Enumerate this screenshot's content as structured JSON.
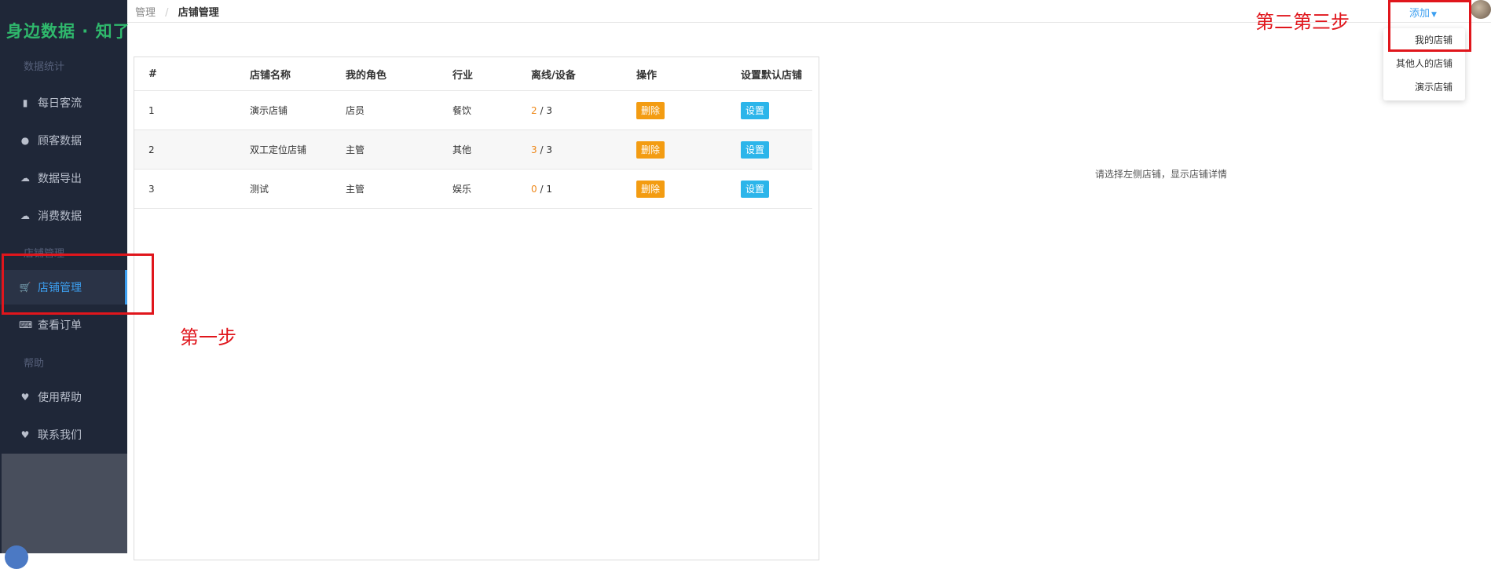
{
  "sidebar": {
    "brand": "身边数据 · 知了",
    "sections": [
      {
        "title": "数据统计"
      },
      {
        "title": "店铺管理"
      },
      {
        "title": "帮助"
      }
    ],
    "items": [
      {
        "label": "每日客流",
        "icon": "bar-chart-icon"
      },
      {
        "label": "顾客数据",
        "icon": "users-icon"
      },
      {
        "label": "数据导出",
        "icon": "cloud-upload-icon"
      },
      {
        "label": "消费数据",
        "icon": "cloud-upload-icon"
      },
      {
        "label": "店铺管理",
        "icon": "cart-icon",
        "active": true
      },
      {
        "label": "查看订单",
        "icon": "keyboard-icon"
      },
      {
        "label": "使用帮助",
        "icon": "heart-icon"
      },
      {
        "label": "联系我们",
        "icon": "heart-icon"
      }
    ],
    "colors": {
      "background": "#1f2738",
      "active": "#3c9ff0",
      "brand": "#2fb86c"
    }
  },
  "breadcrumb": {
    "root": "管理",
    "current": "店铺管理"
  },
  "header": {
    "add_label": "添加",
    "dropdown": [
      "我的店铺",
      "其他人的店铺",
      "演示店铺"
    ]
  },
  "table": {
    "columns": [
      "#",
      "店铺名称",
      "我的角色",
      "行业",
      "离线/设备",
      "操作",
      "设置默认店铺"
    ],
    "rows": [
      {
        "no": "1",
        "name": "演示店铺",
        "role": "店员",
        "industry": "餐饮",
        "offline": "2",
        "devices": "3",
        "action": "删除",
        "set": "设置"
      },
      {
        "no": "2",
        "name": "双工定位店铺",
        "role": "主管",
        "industry": "其他",
        "offline": "3",
        "devices": "3",
        "action": "删除",
        "set": "设置"
      },
      {
        "no": "3",
        "name": "测试",
        "role": "主管",
        "industry": "娱乐",
        "offline": "0",
        "devices": "1",
        "action": "删除",
        "set": "设置"
      }
    ],
    "colors": {
      "delete": "#f39c12",
      "set": "#2cb5ea",
      "offline": "#ee8a1e"
    }
  },
  "detail": {
    "placeholder": "请选择左侧店铺，显示店铺详情"
  },
  "annotations": {
    "step1": "第一步",
    "step23": "第二第三步",
    "color": "#e0161c"
  }
}
